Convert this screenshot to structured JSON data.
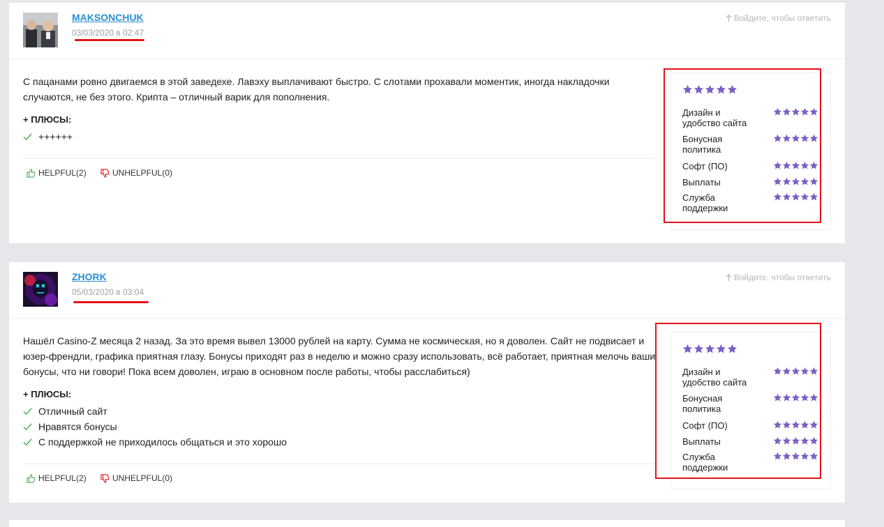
{
  "reply_link": "Войдите, чтобы ответить",
  "pros_title": "+ ПЛЮСЫ:",
  "vote_labels": {
    "helpful": "HELPFUL",
    "unhelpful": "UNHELPFUL"
  },
  "star_color": "#7b5fc4",
  "accent_red": "#e3121b",
  "rating_labels": [
    "Дизайн и удобство сайта",
    "Бонусная политика",
    "Софт (ПО)",
    "Выплаты",
    "Служба поддержки"
  ],
  "reviews": [
    {
      "username": "MAKSONCHUK",
      "date": "03/03/2020 в 02:47",
      "text": "С пацанами ровно двигаемся в этой заведехе. Лавэху выплачивают быстро. С слотами прохавали моментик, иногда накладочки случаются, не без этого. Крипта – отличный варик для пополнения.",
      "pros": [
        "++++++"
      ],
      "helpful_count": "(2)",
      "unhelpful_count": "(0)",
      "overall_rating": 5,
      "ratings": [
        5,
        5,
        5,
        5,
        5
      ]
    },
    {
      "username": "ZHORK",
      "date": "05/03/2020 в 03:04",
      "text": "Нашёл Casino-Z месяца 2 назад. За это время вывел 13000 рублей на карту. Сумма не космическая, но я доволен. Сайт не подвисает и юзер-френдли, графика приятная глазу. Бонусы приходят раз в неделю и можно сразу использовать, всё работает, приятная мелочь ваши бонусы, что ни говори! Пока всем доволен, играю в основном после работы, чтобы расслабиться)",
      "pros": [
        "Отличный сайт",
        "Нравятся бонусы",
        "С поддержкой не приходилось общаться и это хорошо"
      ],
      "helpful_count": "(2)",
      "unhelpful_count": "(0)",
      "overall_rating": 5,
      "ratings": [
        5,
        5,
        5,
        5,
        5
      ]
    }
  ]
}
